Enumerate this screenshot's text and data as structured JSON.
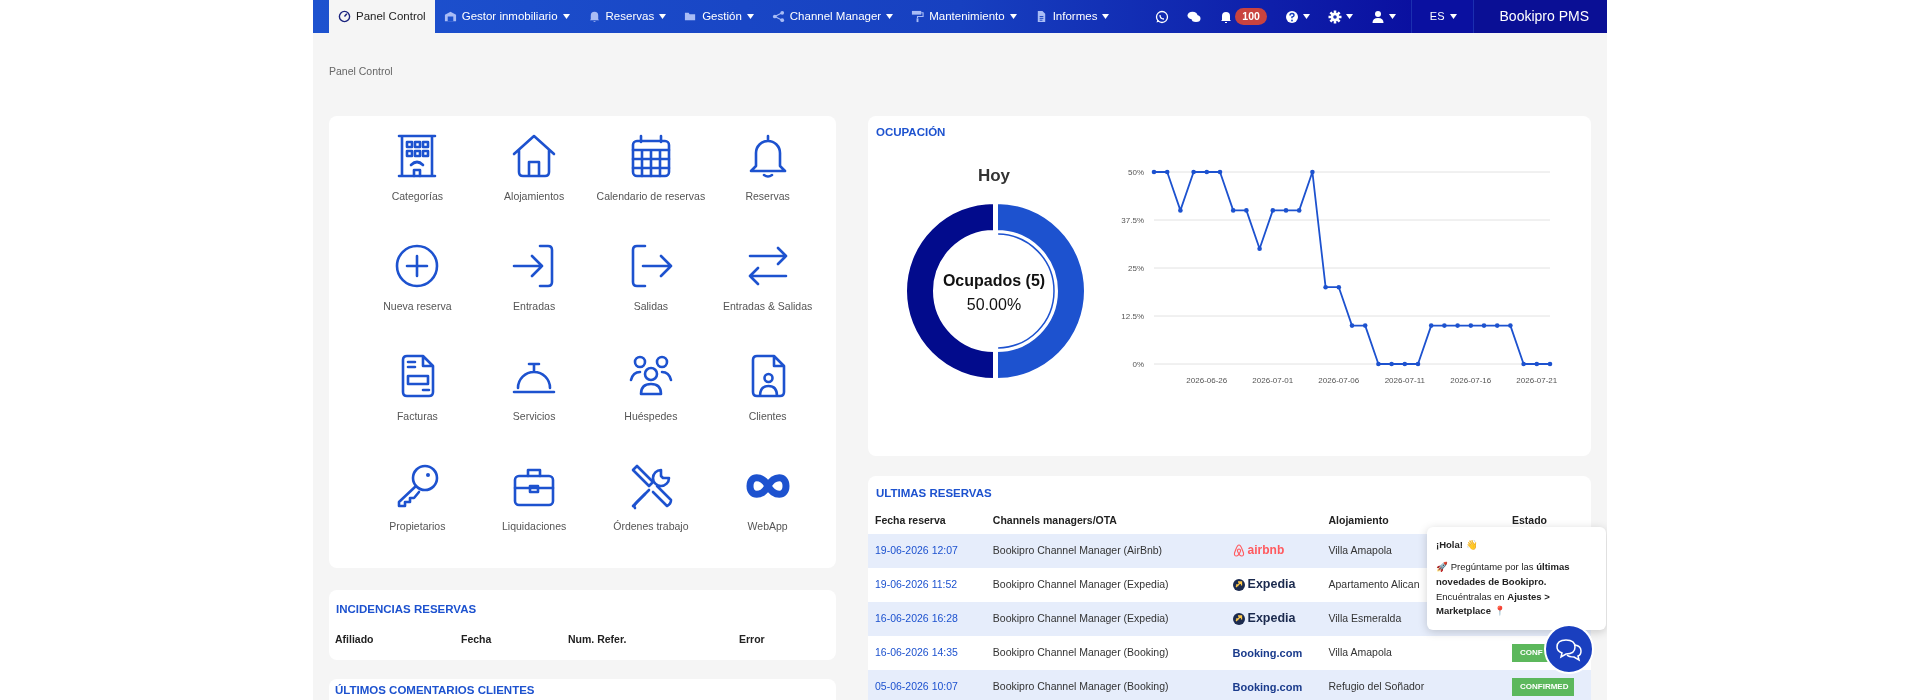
{
  "navbar": {
    "items": [
      {
        "label": "Panel Control",
        "selected": true,
        "dropdown": false
      },
      {
        "label": "Gestor inmobiliario",
        "selected": false,
        "dropdown": true
      },
      {
        "label": "Reservas",
        "selected": false,
        "dropdown": true
      },
      {
        "label": "Gestión",
        "selected": false,
        "dropdown": true
      },
      {
        "label": "Channel Manager",
        "selected": false,
        "dropdown": true
      },
      {
        "label": "Mantenimiento",
        "selected": false,
        "dropdown": true
      },
      {
        "label": "Informes",
        "selected": false,
        "dropdown": true
      }
    ],
    "notifications_badge": "100",
    "language": "ES",
    "brand": "Bookipro PMS"
  },
  "breadcrumb": "Panel Control",
  "shortcuts": [
    {
      "label": "Categorías"
    },
    {
      "label": "Alojamientos"
    },
    {
      "label": "Calendario de reservas"
    },
    {
      "label": "Reservas"
    },
    {
      "label": "Nueva reserva"
    },
    {
      "label": "Entradas"
    },
    {
      "label": "Salidas"
    },
    {
      "label": "Entradas & Salidas"
    },
    {
      "label": "Facturas"
    },
    {
      "label": "Servicios"
    },
    {
      "label": "Huéspedes"
    },
    {
      "label": "Clientes"
    },
    {
      "label": "Propietarios"
    },
    {
      "label": "Liquidaciones"
    },
    {
      "label": "Órdenes trabajo"
    },
    {
      "label": "WebApp"
    }
  ],
  "incidents": {
    "title": "INCIDENCIAS RESERVAS",
    "columns": [
      "Afiliado",
      "Fecha",
      "Num. Refer.",
      "Error"
    ]
  },
  "comments": {
    "title": "ÚLTIMOS COMENTARIOS CLIENTES"
  },
  "occupancy": {
    "title": "OCUPACIÓN",
    "donut_label": "Ocupados (5)",
    "donut_value": "50.00%",
    "donut": {
      "chart_data": {
        "type": "donut",
        "title": "Hoy",
        "values": [
          50,
          50
        ],
        "colors": [
          "#1d52cf",
          "#020b8c"
        ]
      }
    },
    "line": {
      "chart_data": {
        "type": "line",
        "x": [
          "2026-06-22",
          "2026-06-23",
          "2026-06-24",
          "2026-06-25",
          "2026-06-26",
          "2026-06-27",
          "2026-06-28",
          "2026-06-29",
          "2026-06-30",
          "2026-07-01",
          "2026-07-02",
          "2026-07-03",
          "2026-07-04",
          "2026-07-05",
          "2026-07-06",
          "2026-07-07",
          "2026-07-08",
          "2026-07-09",
          "2026-07-10",
          "2026-07-11",
          "2026-07-12",
          "2026-07-13",
          "2026-07-14",
          "2026-07-15",
          "2026-07-16",
          "2026-07-17",
          "2026-07-18",
          "2026-07-19",
          "2026-07-20",
          "2026-07-21",
          "2026-07-22"
        ],
        "series": [
          {
            "color": "#1d52cf",
            "values": [
              50,
              50,
              40,
              50,
              50,
              50,
              40,
              40,
              30,
              40,
              40,
              40,
              50,
              20,
              20,
              10,
              10,
              0,
              0,
              0,
              0,
              10,
              10,
              10,
              10,
              10,
              10,
              10,
              0,
              0,
              0
            ]
          }
        ],
        "xlim": [
          "2026-06-22",
          "2026-07-22"
        ],
        "grid": true,
        "ylim": [
          0,
          50
        ],
        "yticks": [
          {
            "value": 0,
            "label": "0%"
          },
          {
            "value": 12.5,
            "label": "12.5%"
          },
          {
            "value": 25,
            "label": "25%"
          },
          {
            "value": 37.5,
            "label": "37.5%"
          },
          {
            "value": 50,
            "label": "50%"
          }
        ],
        "xticks": [
          "2026-06-26",
          "2026-07-01",
          "2026-07-06",
          "2026-07-11",
          "2026-07-16",
          "2026-07-21"
        ]
      }
    }
  },
  "latest_bookings": {
    "title": "ULTIMAS RESERVAS",
    "columns": [
      "Fecha reserva",
      "Channels managers/OTA",
      "",
      "Alojamiento",
      "Estado"
    ],
    "rows": [
      {
        "date": "19-06-2026 12:07",
        "channel": "Bookipro Channel Manager (AirBnb)",
        "kind": "airbnb",
        "ota_logo": "airbnb",
        "property": "Villa Amapola"
      },
      {
        "date": "19-06-2026 11:52",
        "channel": "Bookipro Channel Manager (Expedia)",
        "kind": "expedia",
        "ota_logo": "Expedia",
        "property": "Apartamento Alican"
      },
      {
        "date": "16-06-2026 16:28",
        "channel": "Bookipro Channel Manager (Expedia)",
        "kind": "expedia",
        "ota_logo": "Expedia",
        "property": "Villa Esmeralda"
      },
      {
        "date": "16-06-2026 14:35",
        "channel": "Bookipro Channel Manager (Booking)",
        "kind": "booking",
        "ota_logo": "Booking.com",
        "property": "Villa Amapola",
        "status": "CONF"
      },
      {
        "date": "05-06-2026 10:07",
        "channel": "Bookipro Channel Manager (Booking)",
        "kind": "booking",
        "ota_logo": "Booking.com",
        "property": "Refugio del Soñador",
        "status": "CONFIRMED"
      }
    ]
  },
  "chat_popup": {
    "greeting": "¡Hola! 👋",
    "message": "🚀 Pregúntame por las **últimas novedades de Bookipro.** Encuéntralas en **Ajustes > Marketplace** 📍"
  }
}
